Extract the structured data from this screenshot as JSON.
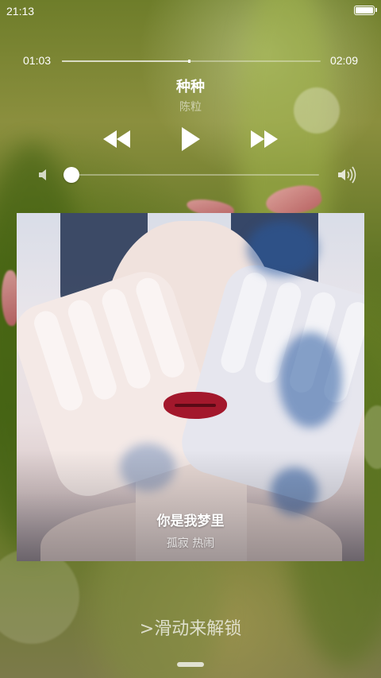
{
  "status_bar": {
    "time": "21:13",
    "battery_icon": "battery-full-icon"
  },
  "player": {
    "elapsed": "01:03",
    "total": "02:09",
    "progress": 0.49,
    "song_title": "种种",
    "artist": "陈粒",
    "controls": {
      "prev_icon": "rewind-icon",
      "play_icon": "play-icon",
      "next_icon": "fast-forward-icon"
    },
    "volume": {
      "level": 0.03,
      "low_icon": "speaker-low-icon",
      "high_icon": "speaker-high-icon"
    }
  },
  "lyrics": {
    "current": "你是我梦里",
    "next": "孤寂 热闹"
  },
  "unlock": {
    "label": ">滑动来解锁"
  },
  "colors": {
    "text": "#ffffff",
    "lips": "#a3182c"
  }
}
